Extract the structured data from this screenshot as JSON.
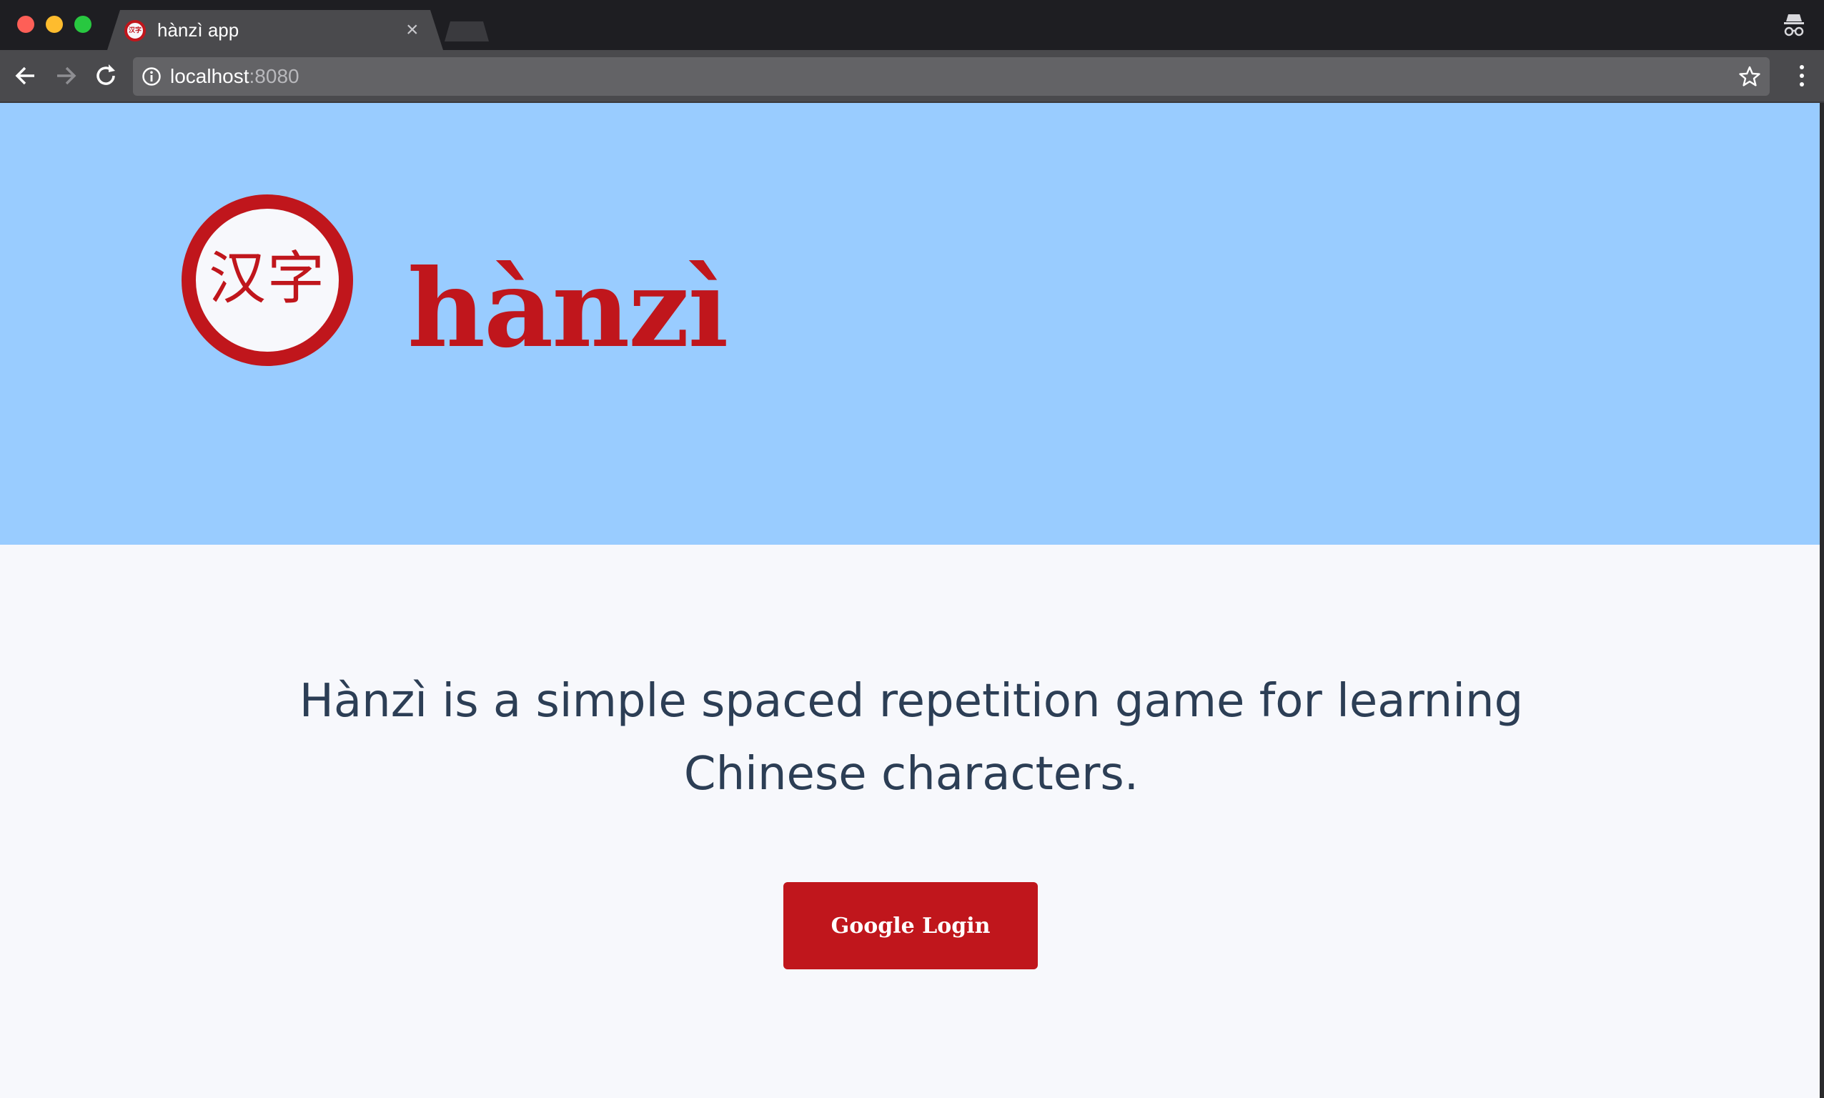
{
  "browser": {
    "tab": {
      "favicon_text": "汉字",
      "title": "hànzì app",
      "close_glyph": "×"
    },
    "address_bar": {
      "host": "localhost",
      "port": ":8080"
    }
  },
  "hero": {
    "logo_chars": "汉字",
    "brand_name": "hànzì",
    "background_color": "#99ccff",
    "accent_color": "#c0161c"
  },
  "main": {
    "tagline": "Hànzì is a simple spaced repetition game for learning Chinese characters.",
    "login_button": "Google Login"
  },
  "icons": [
    "back-arrow-icon",
    "forward-arrow-icon",
    "reload-icon",
    "info-icon",
    "star-icon",
    "menu-icon",
    "incognito-icon"
  ]
}
